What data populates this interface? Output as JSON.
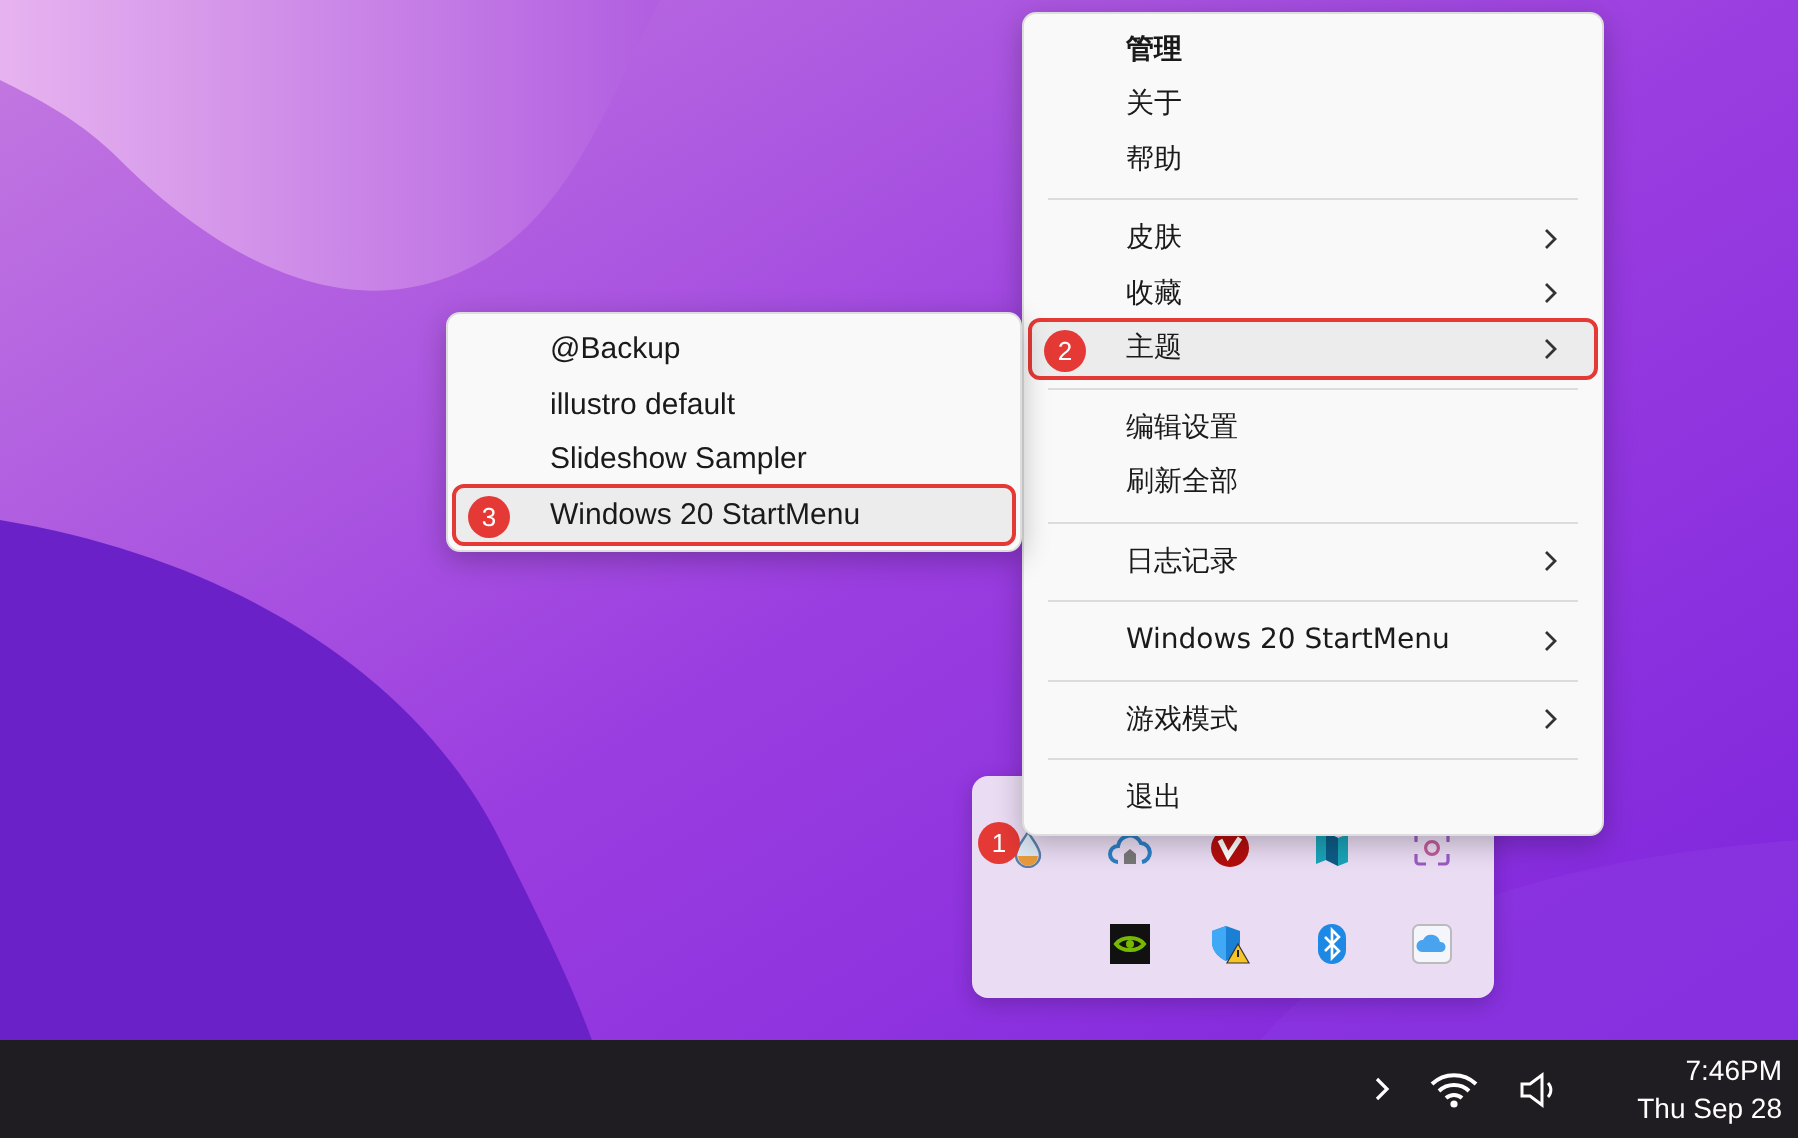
{
  "context_menu": {
    "items": [
      {
        "kind": "item",
        "label": "管理",
        "bold": true,
        "submenu": false,
        "selected": false
      },
      {
        "kind": "item",
        "label": "关于",
        "bold": false,
        "submenu": false,
        "selected": false
      },
      {
        "kind": "item",
        "label": "帮助",
        "bold": false,
        "submenu": false,
        "selected": false
      },
      {
        "kind": "separator"
      },
      {
        "kind": "item",
        "label": "皮肤",
        "bold": false,
        "submenu": true,
        "selected": false
      },
      {
        "kind": "item",
        "label": "收藏",
        "bold": false,
        "submenu": true,
        "selected": false
      },
      {
        "kind": "item",
        "label": "主题",
        "bold": false,
        "submenu": true,
        "selected": true,
        "badge": "2"
      },
      {
        "kind": "separator"
      },
      {
        "kind": "item",
        "label": "编辑设置",
        "bold": false,
        "submenu": false,
        "selected": false
      },
      {
        "kind": "item",
        "label": "刷新全部",
        "bold": false,
        "submenu": false,
        "selected": false
      },
      {
        "kind": "separator"
      },
      {
        "kind": "item",
        "label": "日志记录",
        "bold": false,
        "submenu": true,
        "selected": false
      },
      {
        "kind": "separator"
      },
      {
        "kind": "item",
        "label": "Windows 20 StartMenu",
        "bold": false,
        "submenu": true,
        "selected": false
      },
      {
        "kind": "separator"
      },
      {
        "kind": "item",
        "label": "游戏模式",
        "bold": false,
        "submenu": true,
        "selected": false
      },
      {
        "kind": "separator"
      },
      {
        "kind": "item",
        "label": "退出",
        "bold": false,
        "submenu": false,
        "selected": false
      }
    ]
  },
  "submenu": {
    "items": [
      {
        "label": "@Backup",
        "selected": false
      },
      {
        "label": "illustro default",
        "selected": false
      },
      {
        "label": "Slideshow Sampler",
        "selected": false
      },
      {
        "label": "Windows 20 StartMenu",
        "selected": true,
        "badge": "3"
      }
    ]
  },
  "tray_overflow": {
    "items": [
      {
        "kind": "droplet",
        "badge": "1"
      },
      {
        "kind": "cloud-house"
      },
      {
        "kind": "red-v"
      },
      {
        "kind": "teal-shape"
      },
      {
        "kind": "camera-frame"
      },
      {
        "kind": "empty"
      },
      {
        "kind": "green-square"
      },
      {
        "kind": "shield-warning"
      },
      {
        "kind": "bluetooth"
      },
      {
        "kind": "cloud"
      }
    ]
  },
  "taskbar": {
    "time": "7:46PM",
    "date": "Thu Sep 28"
  }
}
